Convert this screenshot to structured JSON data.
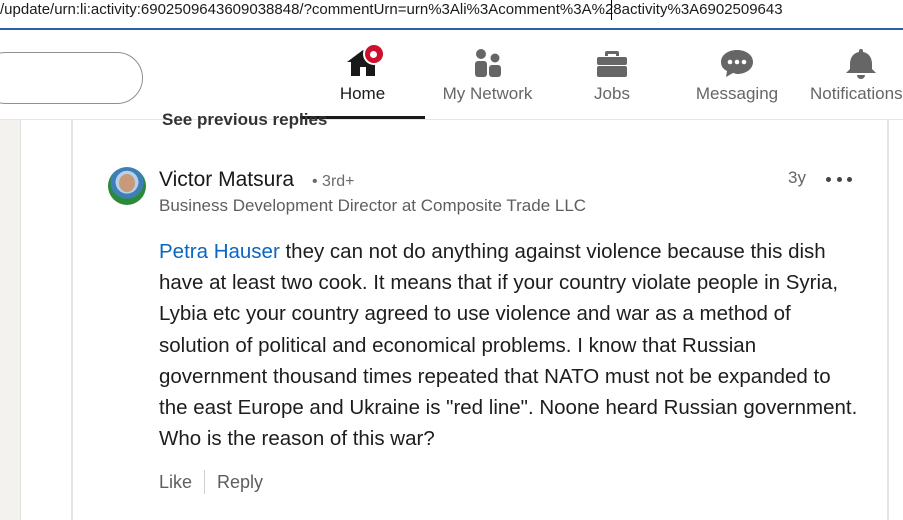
{
  "browser": {
    "url": "/update/urn:li:activity:6902509643609038848/?commentUrn=urn%3Ali%3Acomment%3A%28activity%3A6902509643"
  },
  "nav": {
    "items": [
      {
        "label": "Home",
        "icon": "home-icon",
        "active": true
      },
      {
        "label": "My Network",
        "icon": "network-icon"
      },
      {
        "label": "Jobs",
        "icon": "briefcase-icon"
      },
      {
        "label": "Messaging",
        "icon": "chat-icon"
      },
      {
        "label": "Notifications",
        "icon": "bell-icon"
      }
    ]
  },
  "thread": {
    "see_previous": "See previous replies"
  },
  "comment": {
    "author": "Victor Matsura",
    "degree": "• 3rd+",
    "headline": "Business Development Director at Composite Trade LLC",
    "time": "3y",
    "mention": "Petra Hauser",
    "text": " they can not do anything against violence because this dish have at least two cook. It means that if your country violate people in Syria, Lybia etc your country agreed to use violence and war as a method of solution of political and economical problems. I know that Russian government thousand times repeated that NATO must not be expanded to the east Europe and Ukraine is \"red line\". Noone heard Russian government. Who is the reason of this war?",
    "like_label": "Like",
    "reply_label": "Reply"
  }
}
